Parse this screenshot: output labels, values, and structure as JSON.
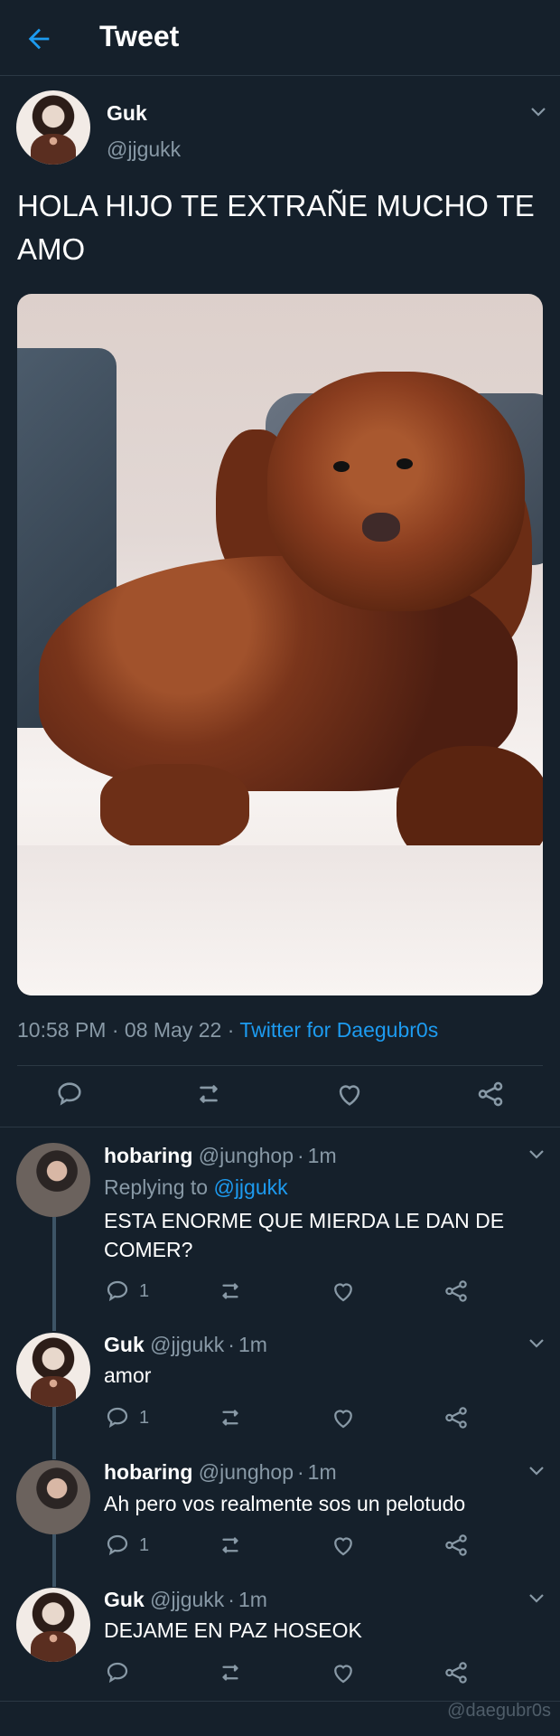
{
  "header": {
    "title": "Tweet",
    "back_icon": "arrow-left-icon"
  },
  "tweet": {
    "author_name": "Guk",
    "author_handle": "@jjgukk",
    "text": "HOLA HIJO TE EXTRAÑE MUCHO TE AMO",
    "time": "10:58 PM",
    "date": "08 May 22",
    "separator": " · ",
    "source": "Twitter for Daegubr0s",
    "actions": [
      "reply-icon",
      "retweet-icon",
      "like-icon",
      "share-icon"
    ]
  },
  "replies": [
    {
      "name": "hobaring",
      "handle": "@junghop",
      "age": "1m",
      "replying_prefix": "Replying to ",
      "replying_to": "@jjgukk",
      "text": "ESTA ENORME QUE MIERDA LE DAN DE COMER?",
      "reply_count": "1"
    },
    {
      "name": "Guk",
      "handle": "@jjgukk",
      "age": "1m",
      "text": "amor",
      "reply_count": "1"
    },
    {
      "name": "hobaring",
      "handle": "@junghop",
      "age": "1m",
      "text": "Ah pero vos realmente sos un pelotudo",
      "reply_count": "1"
    },
    {
      "name": "Guk",
      "handle": "@jjgukk",
      "age": "1m",
      "text": "DEJAME EN PAZ HOSEOK",
      "reply_count": ""
    }
  ],
  "watermark": "@daegubr0s",
  "colors": {
    "background": "#15202b",
    "secondary_text": "#8899a6",
    "accent": "#1d9bf0",
    "divider": "#2b3844"
  }
}
